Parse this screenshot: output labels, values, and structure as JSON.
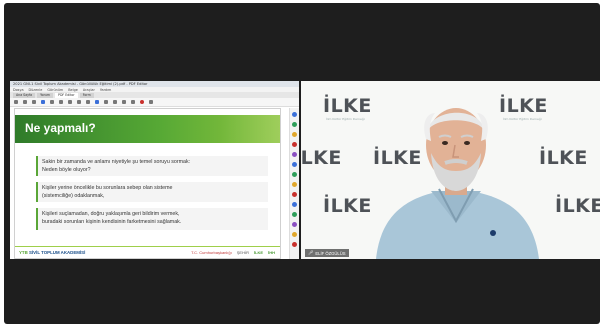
{
  "shared_screen": {
    "title": "2021 GNI-1 Sivil Toplum Akademisi - Gönüllülük Eğitimi (2).pdf - PDF Editor",
    "menu": [
      "Dosya",
      "Düzenle",
      "Görünüm",
      "Belge",
      "Araçlar",
      "Yardım"
    ],
    "tabs": [
      "Ana Sayfa",
      "Yorum",
      "PDF Editor",
      "Form"
    ],
    "slide": {
      "heading": "Ne yapmalı?",
      "bullets": [
        {
          "line1": "Sakin bir zamanda ve anlamı niyetiyle şu temel soruyu sormak:",
          "line2": "Neden böyle oluyor?"
        },
        {
          "line1": "Kişiler yerine  öncelikle bu sorunlara sebep olan sisteme",
          "line2": "(sistemciliğe) odaklanmak,"
        },
        {
          "line1": "Kişileri suçlamadan, doğru yaklaşımla geri bildirim vermek,",
          "line2": "buradaki sorunları kişinin kendisinin farketmesini sağlamak."
        }
      ],
      "footer": {
        "prefix": "YTB",
        "main": "SİVİL TOPLUM AKADEMİSİ",
        "logos": [
          "T.C. Cumhurbaşkanlığı",
          "ŞEHİR",
          "İLKE",
          "İHH"
        ]
      }
    }
  },
  "camera": {
    "watermark": "İLKE",
    "watermark_tagline": "İlim Kültür Eğitim Derneği",
    "participant_name": "ELİF ÖZGÜLÜS"
  },
  "colors": {
    "banner_dark": "#2f7b2a",
    "banner_light": "#8ec53f",
    "accent_green": "#5aa637",
    "footer_blue": "#1a4f8a",
    "meeting_background": "#1e1e1e"
  }
}
